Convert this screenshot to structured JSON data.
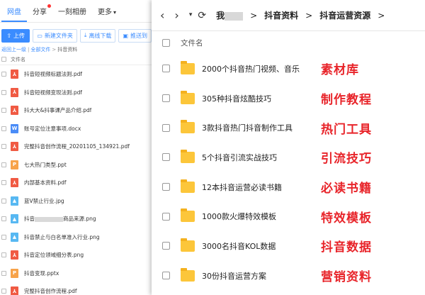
{
  "left": {
    "nav": {
      "tabs": [
        "网盘",
        "分享",
        "一刻相册",
        "更多"
      ],
      "more_caret": "▾"
    },
    "toolbar": {
      "upload": "上传",
      "new_folder": "新建文件夹",
      "offline_download": "离线下载",
      "push": "推送到"
    },
    "breadcrumb": {
      "back": "返回上一级",
      "all_files": "全部文件",
      "current": "抖音资料",
      "sep": "|",
      "sep2": ">"
    },
    "column_header": "文件名",
    "files": [
      {
        "type": "pdf",
        "icon": "pdf-icon",
        "name": "抖音短视频标题法则.pdf"
      },
      {
        "type": "pdf",
        "icon": "pdf-icon",
        "name": "抖音短视频变现法则.pdf"
      },
      {
        "type": "pdf",
        "icon": "pdf-icon",
        "name": "抖大大&抖事课产品介绍.pdf"
      },
      {
        "type": "doc",
        "icon": "word-icon",
        "name": "账号定位注意事项.docx"
      },
      {
        "type": "pdf",
        "icon": "pdf-icon",
        "name": "完整抖音创作流程_20201105_134921.pdf"
      },
      {
        "type": "ppt",
        "icon": "ppt-icon",
        "name": "七大热门类型.ppt"
      },
      {
        "type": "pdf",
        "icon": "pdf-icon",
        "name": "内部基本资料.pdf"
      },
      {
        "type": "img",
        "icon": "image-icon",
        "name": "蓝V禁止行业.jpg"
      },
      {
        "type": "img",
        "icon": "image-icon",
        "name_prefix": "抖音",
        "name": "商品来源.png"
      },
      {
        "type": "img",
        "icon": "image-icon",
        "name": "抖音禁止与白名单准入行业.png"
      },
      {
        "type": "pdf",
        "icon": "pdf-icon",
        "name": "抖音定位领域细分表.png"
      },
      {
        "type": "ppt",
        "icon": "ppt-icon",
        "name": "抖音变现.pptx"
      },
      {
        "type": "pdf",
        "icon": "pdf-icon",
        "name": "完整抖音创作流程.pdf"
      }
    ],
    "icon_glyphs": {
      "pdf": "⅄",
      "doc": "W",
      "ppt": "P",
      "img": "▲"
    }
  },
  "right": {
    "address": {
      "back": "‹",
      "forward": "›",
      "dropdown": "▾",
      "refresh": "⟳",
      "root": "我",
      "path": [
        "抖音资料",
        "抖音运营资源"
      ],
      "sep": ">"
    },
    "column_header": "文件名",
    "folders": [
      {
        "name": "2000个抖音热门视频、音乐",
        "label": "素材库"
      },
      {
        "name": "305种抖音炫酷技巧",
        "label": "制作教程"
      },
      {
        "name": "3款抖音热门抖音制作工具",
        "label": "热门工具"
      },
      {
        "name": "5个抖音引流实战技巧",
        "label": "引流技巧"
      },
      {
        "name": "12本抖音运营必读书籍",
        "label": "必读书籍"
      },
      {
        "name": "1000款火爆特效模板",
        "label": "特效模板"
      },
      {
        "name": "3000名抖音KOL数据",
        "label": "抖音数据"
      },
      {
        "name": "30份抖音运营方案",
        "label": "营销资料"
      }
    ],
    "label_color": "#e8242a",
    "folder_color": "#fcc63a"
  },
  "colors": {
    "accent": "#3b8cff",
    "badge": "#ff3333"
  }
}
